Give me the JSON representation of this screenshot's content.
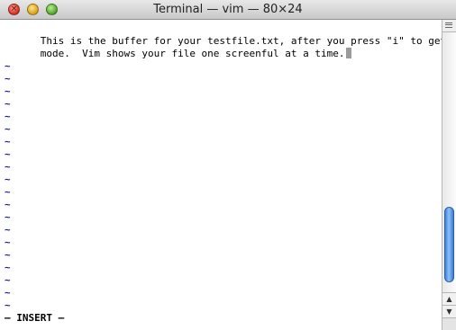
{
  "window": {
    "title": "Terminal — vim — 80×24"
  },
  "icons": {
    "close": "close-icon",
    "minimize": "minimize-icon",
    "zoom": "zoom-icon",
    "split": "split-pane-icon",
    "scroll_up": "arrow-up-icon",
    "scroll_down": "arrow-down-icon"
  },
  "editor": {
    "lines": [
      "This is the buffer for your testfile.txt, after you press \"i\" to get into INSERT",
      "mode.  Vim shows your file one screenful at a time."
    ],
    "empty_line_marker": "~",
    "status_line": "— INSERT —"
  },
  "colors": {
    "tilde": "#1a1aa6",
    "scroll_thumb": "#5b9ae8"
  }
}
